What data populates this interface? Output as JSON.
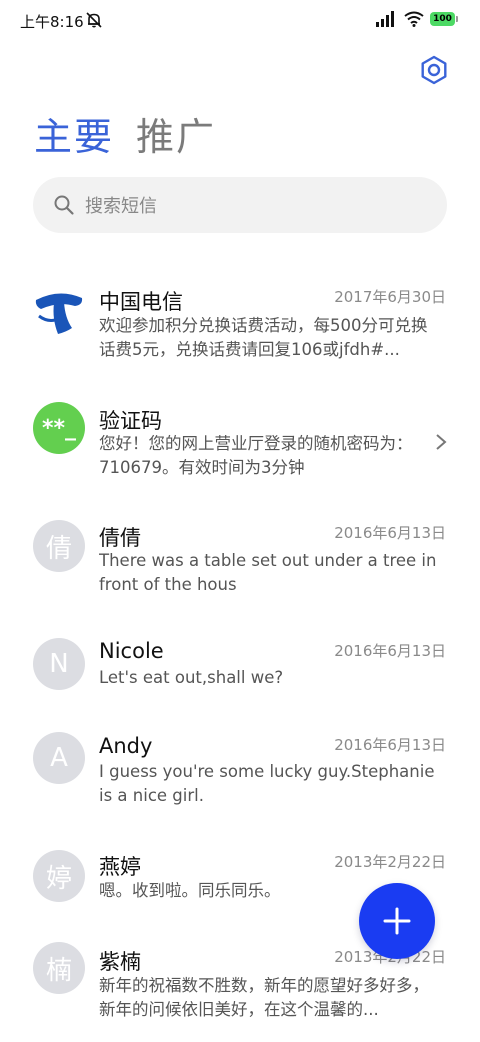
{
  "status_bar": {
    "time": "上午8:16",
    "battery": "100"
  },
  "tabs": [
    {
      "label": "主要"
    },
    {
      "label": "推广"
    }
  ],
  "search": {
    "placeholder": "搜索短信"
  },
  "messages": [
    {
      "name": "中国电信",
      "date": "2017年6月30日",
      "preview": "欢迎参加积分兑换话费活动，每500分可兑换话费5元，兑换话费请回复106或jfdh#..."
    },
    {
      "name": "验证码",
      "avatar_text": "**_",
      "preview": "您好！您的网上营业厅登录的随机密码为：710679。有效时间为3分钟"
    },
    {
      "name": "倩倩",
      "avatar_text": "倩",
      "date": "2016年6月13日",
      "preview": "There was a table set out under a tree in front of the hous"
    },
    {
      "name": "Nicole",
      "avatar_text": "N",
      "date": "2016年6月13日",
      "preview": "Let's eat out,shall we?"
    },
    {
      "name": "Andy",
      "avatar_text": "A",
      "date": "2016年6月13日",
      "preview": "I guess you're some lucky guy.Stephanie is a nice girl."
    },
    {
      "name": "燕婷",
      "avatar_text": "婷",
      "date": "2013年2月22日",
      "preview": "嗯。收到啦。同乐同乐。"
    },
    {
      "name": "紫楠",
      "avatar_text": "楠",
      "date": "2013年2月22日",
      "preview": "新年的祝福数不胜数，新年的愿望好多好多，新年的问候依旧美好，在这个温馨的..."
    }
  ],
  "colors": {
    "accent": "#3a63d8",
    "fab": "#1a3cf2",
    "verify_avatar": "#63cf4f"
  }
}
